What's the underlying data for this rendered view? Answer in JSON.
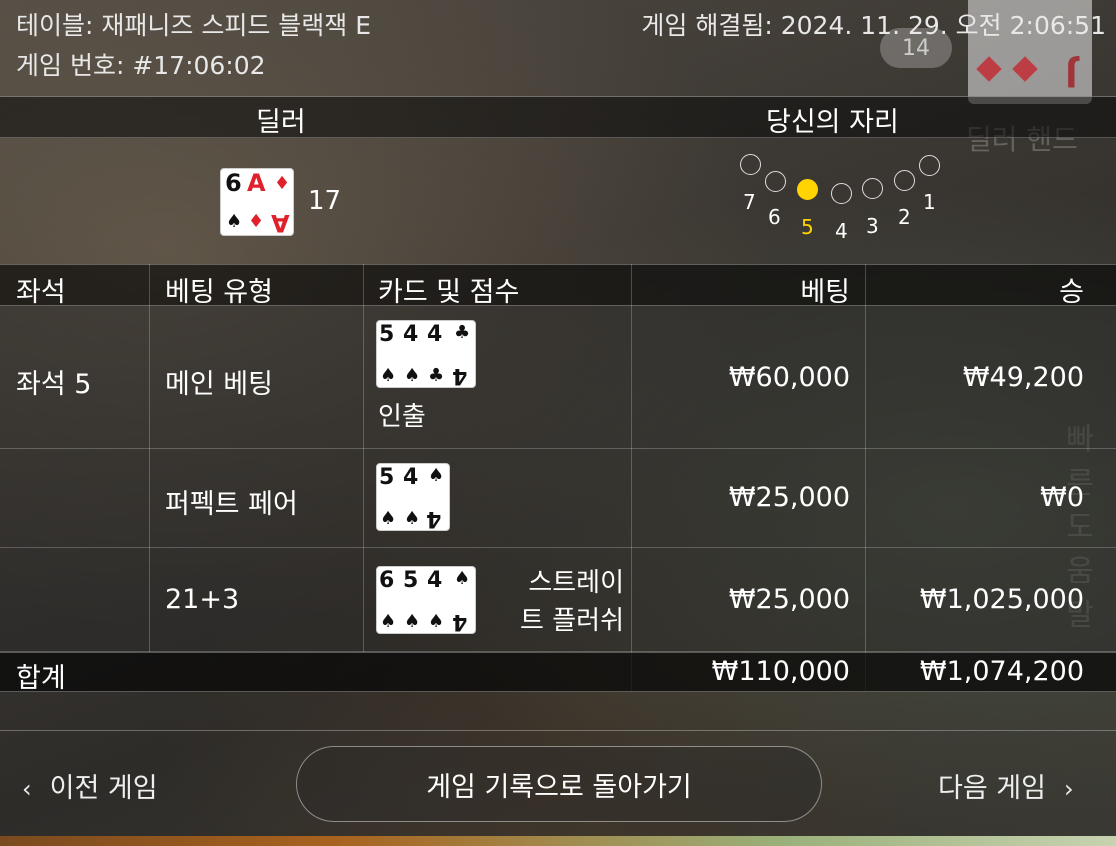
{
  "header": {
    "table_name": "테이블: 재패니즈 스피드 블랙잭 E",
    "game_number": "게임 번호: #17:06:02",
    "resolved": "게임 해결됨: 2024. 11. 29. 오전 2:06:51"
  },
  "overlay": {
    "badge": "14",
    "dealer_hand_label": "딜러 핸드",
    "side_label": "빠른 도움말",
    "ghost_card_rank": "J"
  },
  "dealer": {
    "title": "딜러",
    "score": "17",
    "cards": [
      {
        "rank": "6",
        "suit": "♠",
        "color": "#111111"
      },
      {
        "rank": "A",
        "suit": "♦",
        "color": "#e0202a"
      }
    ]
  },
  "seat": {
    "title": "당신의 자리",
    "seats": [
      "7",
      "6",
      "5",
      "4",
      "3",
      "2",
      "1"
    ],
    "active": "5",
    "active_color": "#ffd400"
  },
  "table": {
    "columns": [
      "좌석",
      "베팅 유형",
      "카드 및 점수",
      "베팅",
      "승"
    ],
    "seat_label": "좌석 5",
    "rows": [
      {
        "type": "메인 베팅",
        "cards": [
          {
            "rank": "5",
            "suit": "♠"
          },
          {
            "rank": "4",
            "suit": "♠"
          },
          {
            "rank": "4",
            "suit": "♣"
          },
          {
            "rank": "4",
            "suit": "♣"
          }
        ],
        "result": "인출",
        "bet": "₩60,000",
        "win": "₩49,200"
      },
      {
        "type": "퍼펙트 페어",
        "cards": [
          {
            "rank": "5",
            "suit": "♠"
          },
          {
            "rank": "4",
            "suit": "♠"
          }
        ],
        "result": "",
        "bet": "₩25,000",
        "win": "₩0"
      },
      {
        "type": "21+3",
        "cards": [
          {
            "rank": "6",
            "suit": "♠"
          },
          {
            "rank": "5",
            "suit": "♠"
          },
          {
            "rank": "4",
            "suit": "♠"
          }
        ],
        "result_line1": "스트레이",
        "result_line2": "트 플러쉬",
        "bet": "₩25,000",
        "win": "₩1,025,000"
      }
    ],
    "total_label": "합계",
    "total_bet": "₩110,000",
    "total_win": "₩1,074,200"
  },
  "footer": {
    "prev": "이전 게임",
    "back": "게임 기록으로 돌아가기",
    "next": "다음 게임"
  }
}
